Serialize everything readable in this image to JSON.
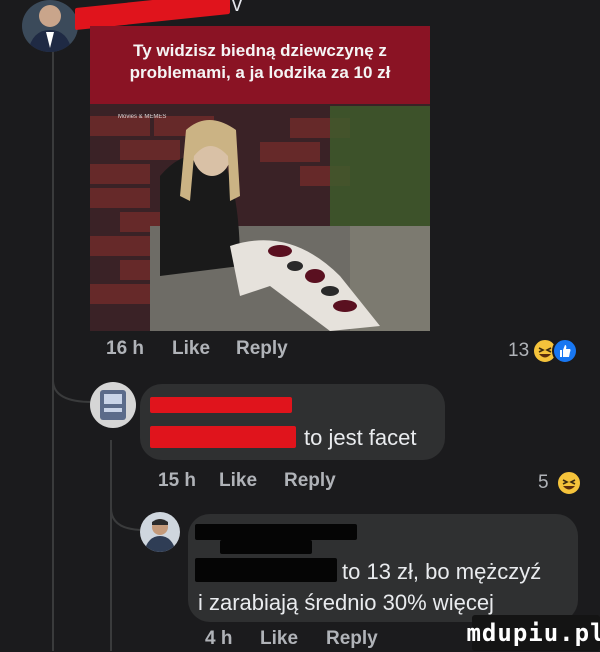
{
  "post": {
    "author_name_partial": "v",
    "meme": {
      "caption": "Ty widzisz biedną dziewczynę z problemami, a ja lodzika za 10 zł",
      "watermark": "Movies & MEMES"
    },
    "meta": {
      "time": "16 h",
      "like_label": "Like",
      "reply_label": "Reply"
    },
    "reactions": {
      "count": "13",
      "types": [
        "haha-icon",
        "like-icon"
      ]
    }
  },
  "comments": [
    {
      "text": "to jest facet",
      "meta": {
        "time": "15 h",
        "like_label": "Like",
        "reply_label": "Reply"
      },
      "reactions": {
        "count": "5",
        "types": [
          "haha-icon"
        ]
      }
    },
    {
      "text_line1": "to 13 zł, bo mężczyź",
      "text_line2": "i zarabiają średnio 30% więcej",
      "meta": {
        "time": "4 h",
        "like_label": "Like",
        "reply_label": "Reply"
      }
    }
  ],
  "watermark_logo": "mdupiu.pl",
  "colors": {
    "background": "#1b1b1d",
    "bubble": "#2f3031",
    "redaction": "#e0141c",
    "meta_text": "#b0b3b8",
    "haha": "#f5c33b",
    "like": "#1877f2"
  }
}
